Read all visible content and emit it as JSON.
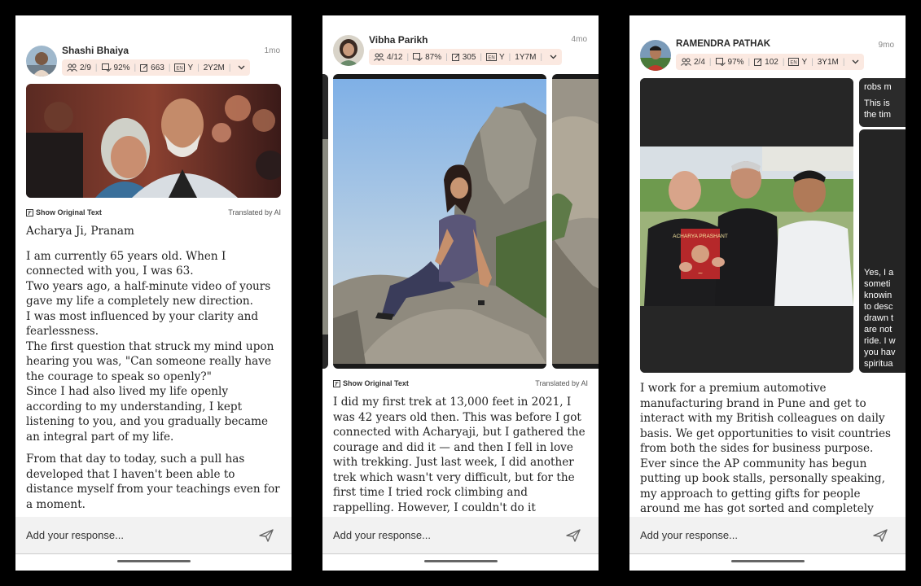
{
  "action_labels": {
    "show_original": "Show Original Text",
    "translated": "Translated by AI",
    "response_placeholder": "Add your response..."
  },
  "posts": [
    {
      "user": "Shashi Bhaiya",
      "time": "1mo",
      "stats": {
        "group": "2/9",
        "completion": "92%",
        "tasks": "663",
        "lang": "Y",
        "tenure": "2Y2M"
      },
      "greeting": "Acharya Ji, Pranam",
      "paragraphs": [
        "I am currently 65 years old. When I connected with you, I was 63.",
        "Two years ago, a half-minute video of yours gave my life a completely new direction.",
        "I was most influenced by your clarity and fearlessness.",
        "The first question that struck my mind upon hearing you was, \"Can someone really have the courage to speak so openly?\"",
        "Since I had also lived my life openly according to my understanding, I kept listening to you, and you gradually became an integral part of my life.",
        "From that day to today, such a pull has developed that I haven't been able to distance myself from your teachings even for a moment."
      ]
    },
    {
      "user": "Vibha Parikh",
      "time": "4mo",
      "stats": {
        "group": "4/12",
        "completion": "87%",
        "tasks": "305",
        "lang": "Y",
        "tenure": "1Y7M"
      },
      "paragraph": "I did my first trek at 13,000 feet in 2021, I was 42 years old then. This was before I got connected with Acharyaji, but I gathered the courage and did it — and then I fell in love with trekking. Just last week, I did another trek which wasn't very difficult, but for the first time I tried rock climbing and rappelling. However, I couldn't do it properly. There was one spot where the"
    },
    {
      "user": "RAMENDRA PATHAK",
      "time": "9mo",
      "stats": {
        "group": "2/4",
        "completion": "97%",
        "tasks": "102",
        "lang": "Y",
        "tenure": "3Y1M"
      },
      "book_title": "ACHARYA PRASHANT",
      "paragraph": "I work for a premium automotive manufacturing brand in Pune and get to interact with my British colleagues on daily basis. We get opportunities to visit countries from both the sides for business purpose. Ever since the AP community has begun putting up book stalls, personally speaking, my approach to getting gifts for people around me has got sorted and completely rejuvenated (Acharyaji's",
      "side_chat": {
        "top_lines": [
          "robs m",
          "This is",
          "the tim"
        ],
        "bottom_lines": [
          "Yes, I a",
          "someti",
          "knowin",
          "to desc",
          "drawn t",
          "are not",
          "ride. I w",
          "you hav",
          "spiritua"
        ]
      }
    }
  ]
}
